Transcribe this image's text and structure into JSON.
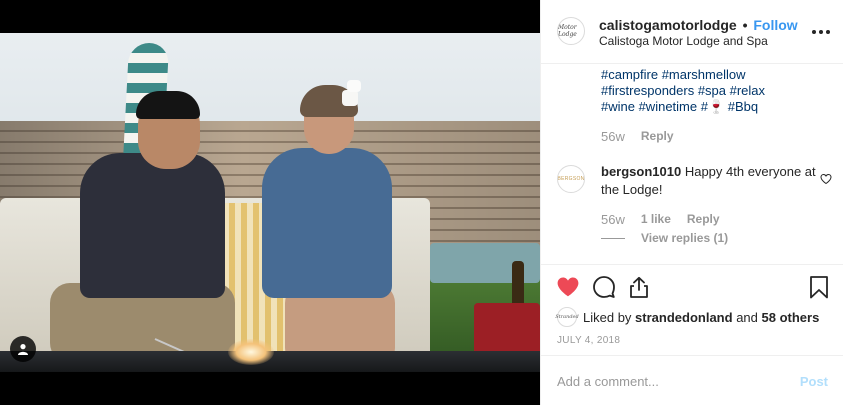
{
  "post": {
    "username": "calistogamotorlodge",
    "separator": "•",
    "follow_label": "Follow",
    "location": "Calistoga Motor Lodge and Spa",
    "avatar_text": "Motor Lodge"
  },
  "caption": {
    "lines": [
      "#campfire #marshmellow",
      "#firstresponders #spa #relax"
    ],
    "line3_a": "#wine #winetime #",
    "line3_emoji": "🍷",
    "line3_b": "#Bbq",
    "age": "56w",
    "reply_label": "Reply"
  },
  "comment": {
    "username": "bergson1010",
    "text": "Happy 4th everyone at the Lodge!",
    "avatar_text": "BERGSON",
    "age": "56w",
    "likes": "1 like",
    "reply_label": "Reply",
    "view_replies": "View replies (1)"
  },
  "likes": {
    "prefix": "Liked by",
    "user": "strandedonland",
    "connector": "and",
    "others": "58 others",
    "avatar_text": "Stranded"
  },
  "date": "JULY 4, 2018",
  "add_comment": {
    "placeholder": "Add a comment...",
    "post_label": "Post"
  },
  "colors": {
    "link_blue": "#3897f0",
    "hashtag": "#003569",
    "like_red": "#ed4956",
    "muted": "#999999"
  }
}
